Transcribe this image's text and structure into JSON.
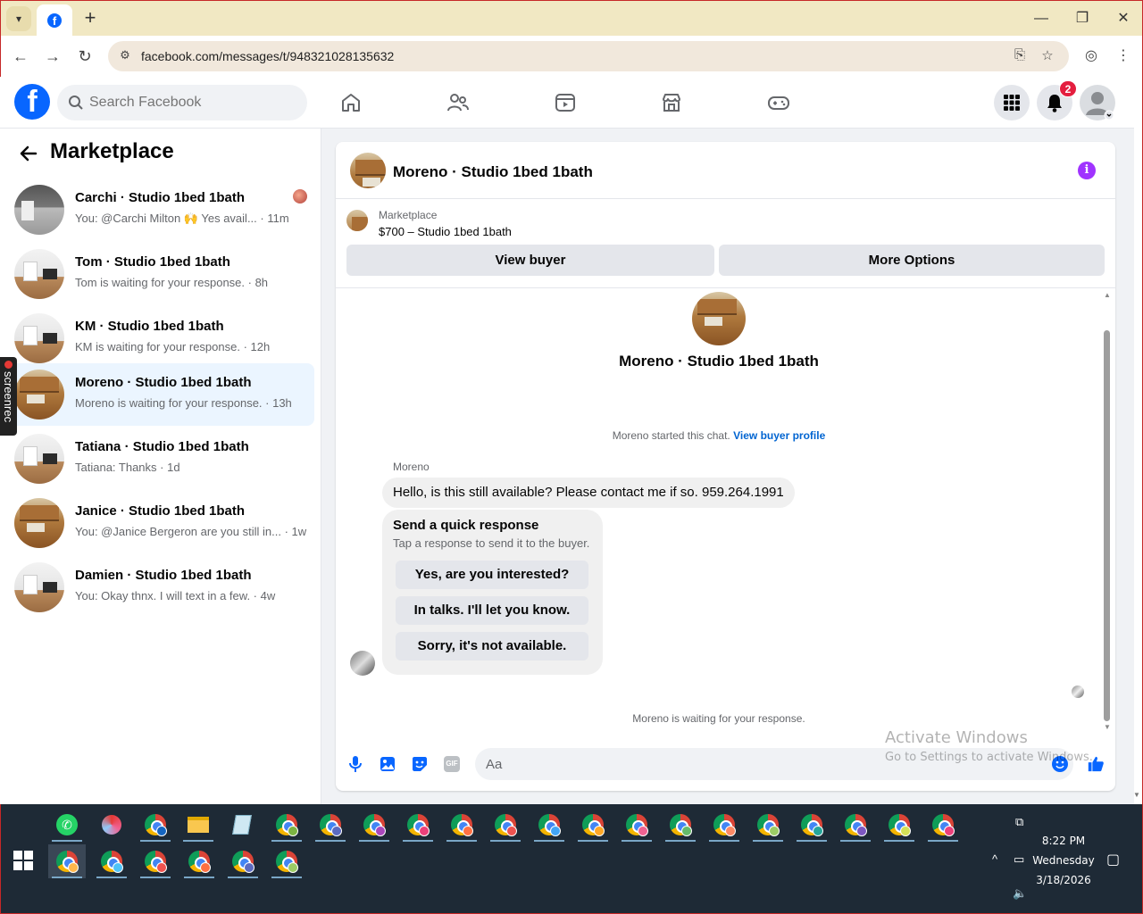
{
  "browser": {
    "tab_icon": "facebook-favicon",
    "new_tab": "+",
    "url": "facebook.com/messages/t/948321028135632",
    "window_controls": [
      "minimize",
      "restore",
      "close"
    ]
  },
  "fb_header": {
    "logo": "f",
    "search_placeholder": "Search Facebook",
    "notification_count": "2",
    "nav_icons": [
      "home-icon",
      "friends-icon",
      "video-icon",
      "marketplace-icon",
      "gaming-icon"
    ]
  },
  "left": {
    "title": "Marketplace",
    "conversations": [
      {
        "name": "Carchi · Studio 1bed 1bath",
        "preview": "You: @Carchi Milton 🙌 Yes avail... · 11m",
        "thumb": "dark"
      },
      {
        "name": "Tom · Studio 1bed 1bath",
        "preview": "Tom is waiting for your response. · 8h",
        "thumb": "room"
      },
      {
        "name": "KM · Studio 1bed 1bath",
        "preview": "KM is waiting for your response. · 12h",
        "thumb": "room"
      },
      {
        "name": "Moreno · Studio 1bed 1bath",
        "preview": "Moreno is waiting for your response. · 13h",
        "thumb": "kitchen"
      },
      {
        "name": "Tatiana · Studio 1bed 1bath",
        "preview": "Tatiana: Thanks · 1d",
        "thumb": "room"
      },
      {
        "name": "Janice · Studio 1bed 1bath",
        "preview": "You: @Janice Bergeron are you still in... · 1w",
        "thumb": "kitchen"
      },
      {
        "name": "Damien · Studio 1bed 1bath",
        "preview": "You: Okay thnx. I will text in a few. · 4w",
        "thumb": "room"
      }
    ]
  },
  "screenrec": "screenrec",
  "chat": {
    "title": "Moreno · Studio 1bed 1bath",
    "listing_label": "Marketplace",
    "listing_price": "$700 – Studio 1bed 1bath",
    "view_buyer": "View buyer",
    "more_options": "More Options",
    "profile_name": "Moreno · Studio 1bed 1bath",
    "started_text": "Moreno started this chat.",
    "started_link": "View buyer profile",
    "sender": "Moreno",
    "message": "Hello, is this still available? Please contact me if so. 959.264.1991",
    "quick_title": "Send a quick response",
    "quick_sub": "Tap a response to send it to the buyer.",
    "quick_replies": [
      "Yes, are you interested?",
      "In talks. I'll let you know.",
      "Sorry, it's not available."
    ],
    "waiting": "Moreno is waiting for your response.",
    "composer_placeholder": "Aa",
    "gif_label": "GIF"
  },
  "watermark": {
    "line1": "Activate Windows",
    "line2": "Go to Settings to activate Windows."
  },
  "taskbar": {
    "time": "8:22 PM",
    "day": "Wednesday",
    "date": "3/18/2026"
  },
  "colors": {
    "fb_blue": "#0866ff",
    "info_purple": "#a033ff",
    "badge_red": "#e41e3f"
  }
}
